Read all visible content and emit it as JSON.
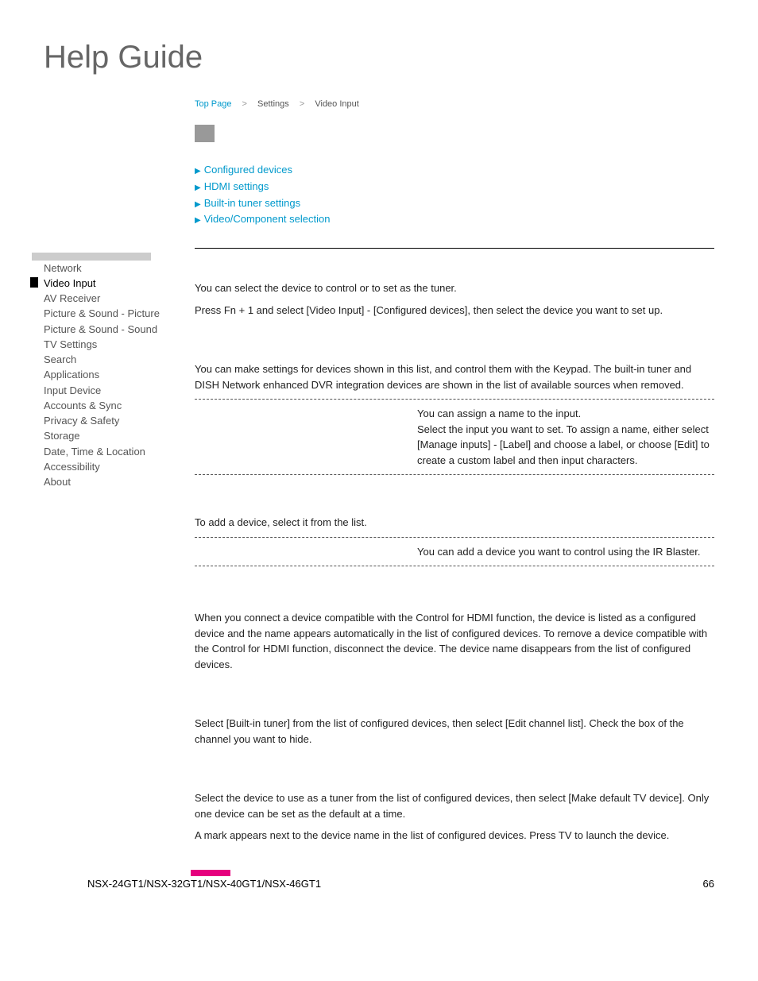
{
  "title": "Help Guide",
  "breadcrumb": {
    "top": "Top Page",
    "mid": "Settings",
    "current": "Video Input"
  },
  "anchors": {
    "a1": "Configured devices",
    "a2": "HDMI settings",
    "a3": "Built-in tuner settings",
    "a4": "Video/Component selection"
  },
  "sidebar": {
    "items": [
      "Network",
      "Video Input",
      "AV Receiver",
      "Picture & Sound - Picture",
      "Picture & Sound - Sound",
      "TV Settings",
      "Search",
      "Applications",
      "Input Device",
      "Accounts & Sync",
      "Privacy & Safety",
      "Storage",
      "Date, Time & Location",
      "Accessibility",
      "About"
    ]
  },
  "content": {
    "p1": "You can select the device to control or to set as the tuner.",
    "p2": "Press Fn + 1 and select [Video Input] - [Configured devices], then select the device you want to set up.",
    "p3": "You can make settings for devices shown in this list, and control them with the Keypad. The built-in tuner and DISH Network enhanced DVR integration devices are shown in the list of available sources when removed.",
    "p4": "You can assign a name to the input.\nSelect the input you want to set. To assign a name, either select [Manage inputs] - [Label] and choose a label, or choose [Edit] to create a custom label and then input characters.",
    "p5": "To add a device, select it from the list.",
    "p6": "You can add a device you want to control using the IR Blaster.",
    "p7": "When you connect a device compatible with the Control for HDMI function, the device is listed as a configured device and the name appears automatically in the list of configured devices. To remove a device compatible with the Control for HDMI function, disconnect the device. The device name disappears from the list of configured devices.",
    "p8": "Select [Built-in tuner] from the list of configured devices, then select [Edit channel list]. Check the box of the channel you want to hide.",
    "p9a": "Select the device to use as a tuner from the list of configured devices, then select [Make default TV device]. Only one device can be set as the default at a time.",
    "p9b": "A mark appears next to the device name in the list of configured devices. Press TV to launch the device."
  },
  "footer": {
    "models": "NSX-24GT1/NSX-32GT1/NSX-40GT1/NSX-46GT1",
    "page": "66"
  }
}
